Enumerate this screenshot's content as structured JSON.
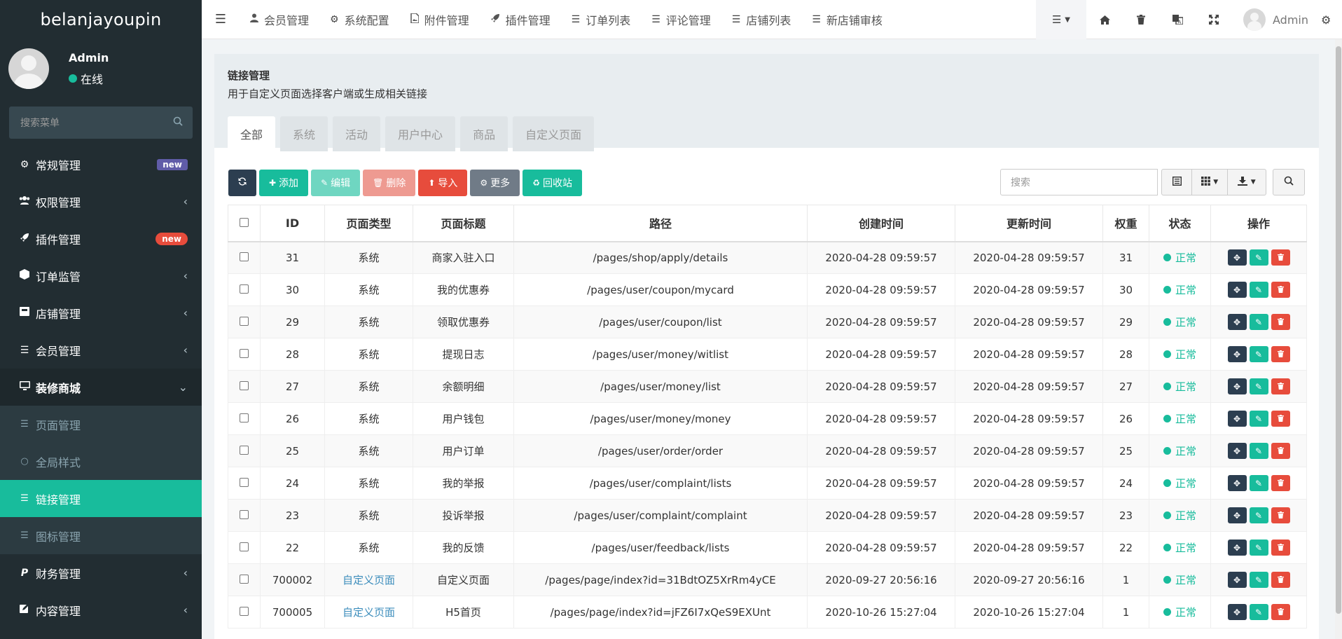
{
  "sidebar": {
    "logo": "belanjayoupin",
    "user": {
      "name": "Admin",
      "status": "在线"
    },
    "search_placeholder": "搜索菜单",
    "items": [
      {
        "label": "常规管理",
        "icon": "cogs-icon",
        "badge": "new"
      },
      {
        "label": "权限管理",
        "icon": "users-icon"
      },
      {
        "label": "插件管理",
        "icon": "rocket-icon",
        "badge": "new"
      },
      {
        "label": "订单监管",
        "icon": "cube-icon"
      },
      {
        "label": "店铺管理",
        "icon": "store-icon"
      },
      {
        "label": "会员管理",
        "icon": "list-icon"
      },
      {
        "label": "装修商城",
        "icon": "desktop-icon"
      },
      {
        "label": "财务管理",
        "icon": "paypal-icon"
      },
      {
        "label": "内容管理",
        "icon": "edit-icon"
      }
    ],
    "sub_items": [
      {
        "label": "页面管理",
        "icon": "list-icon"
      },
      {
        "label": "全局样式",
        "icon": "circle-icon"
      },
      {
        "label": "链接管理",
        "icon": "list-icon"
      },
      {
        "label": "图标管理",
        "icon": "list-icon"
      }
    ]
  },
  "topbar": {
    "nav": [
      {
        "label": "会员管理",
        "icon": "user-icon"
      },
      {
        "label": "系统配置",
        "icon": "cog-icon"
      },
      {
        "label": "附件管理",
        "icon": "file-image-icon"
      },
      {
        "label": "插件管理",
        "icon": "rocket-icon"
      },
      {
        "label": "订单列表",
        "icon": "list-icon"
      },
      {
        "label": "评论管理",
        "icon": "list-icon"
      },
      {
        "label": "店铺列表",
        "icon": "list-icon"
      },
      {
        "label": "新店铺审核",
        "icon": "list-icon"
      }
    ],
    "user": "Admin"
  },
  "panel": {
    "title": "链接管理",
    "description": "用于自定义页面选择客户端或生成相关链接",
    "tabs": [
      "全部",
      "系统",
      "活动",
      "用户中心",
      "商品",
      "自定义页面"
    ]
  },
  "toolbar": {
    "add": "添加",
    "edit": "编辑",
    "delete": "删除",
    "import": "导入",
    "more": "更多",
    "recycle": "回收站",
    "search_placeholder": "搜索"
  },
  "table": {
    "columns": [
      "ID",
      "页面类型",
      "页面标题",
      "路径",
      "创建时间",
      "更新时间",
      "权重",
      "状态",
      "操作"
    ],
    "rows": [
      {
        "id": "31",
        "type": "系统",
        "title": "商家入驻入口",
        "path": "/pages/shop/apply/details",
        "created": "2020-04-28 09:59:57",
        "updated": "2020-04-28 09:59:57",
        "weight": "31",
        "status": "正常"
      },
      {
        "id": "30",
        "type": "系统",
        "title": "我的优惠券",
        "path": "/pages/user/coupon/mycard",
        "created": "2020-04-28 09:59:57",
        "updated": "2020-04-28 09:59:57",
        "weight": "30",
        "status": "正常"
      },
      {
        "id": "29",
        "type": "系统",
        "title": "领取优惠券",
        "path": "/pages/user/coupon/list",
        "created": "2020-04-28 09:59:57",
        "updated": "2020-04-28 09:59:57",
        "weight": "29",
        "status": "正常"
      },
      {
        "id": "28",
        "type": "系统",
        "title": "提现日志",
        "path": "/pages/user/money/witlist",
        "created": "2020-04-28 09:59:57",
        "updated": "2020-04-28 09:59:57",
        "weight": "28",
        "status": "正常"
      },
      {
        "id": "27",
        "type": "系统",
        "title": "余额明细",
        "path": "/pages/user/money/list",
        "created": "2020-04-28 09:59:57",
        "updated": "2020-04-28 09:59:57",
        "weight": "27",
        "status": "正常"
      },
      {
        "id": "26",
        "type": "系统",
        "title": "用户钱包",
        "path": "/pages/user/money/money",
        "created": "2020-04-28 09:59:57",
        "updated": "2020-04-28 09:59:57",
        "weight": "26",
        "status": "正常"
      },
      {
        "id": "25",
        "type": "系统",
        "title": "用户订单",
        "path": "/pages/user/order/order",
        "created": "2020-04-28 09:59:57",
        "updated": "2020-04-28 09:59:57",
        "weight": "25",
        "status": "正常"
      },
      {
        "id": "24",
        "type": "系统",
        "title": "我的举报",
        "path": "/pages/user/complaint/lists",
        "created": "2020-04-28 09:59:57",
        "updated": "2020-04-28 09:59:57",
        "weight": "24",
        "status": "正常"
      },
      {
        "id": "23",
        "type": "系统",
        "title": "投诉举报",
        "path": "/pages/user/complaint/complaint",
        "created": "2020-04-28 09:59:57",
        "updated": "2020-04-28 09:59:57",
        "weight": "23",
        "status": "正常"
      },
      {
        "id": "22",
        "type": "系统",
        "title": "我的反馈",
        "path": "/pages/user/feedback/lists",
        "created": "2020-04-28 09:59:57",
        "updated": "2020-04-28 09:59:57",
        "weight": "22",
        "status": "正常"
      },
      {
        "id": "700002",
        "type": "自定义页面",
        "title": "自定义页面",
        "path": "/pages/page/index?id=31BdtOZ5XrRm4yCE",
        "created": "2020-09-27 20:56:16",
        "updated": "2020-09-27 20:56:16",
        "weight": "1",
        "status": "正常"
      },
      {
        "id": "700005",
        "type": "自定义页面",
        "title": "H5首页",
        "path": "/pages/page/index?id=jFZ6I7xQeS9EXUnt",
        "created": "2020-10-26 15:27:04",
        "updated": "2020-10-26 15:27:04",
        "weight": "1",
        "status": "正常"
      }
    ]
  },
  "colors": {
    "primary": "#18bc9c",
    "dark": "#2c3e50",
    "danger": "#e74c3c",
    "sidebar": "#222d32",
    "link": "#3c8dbc"
  }
}
